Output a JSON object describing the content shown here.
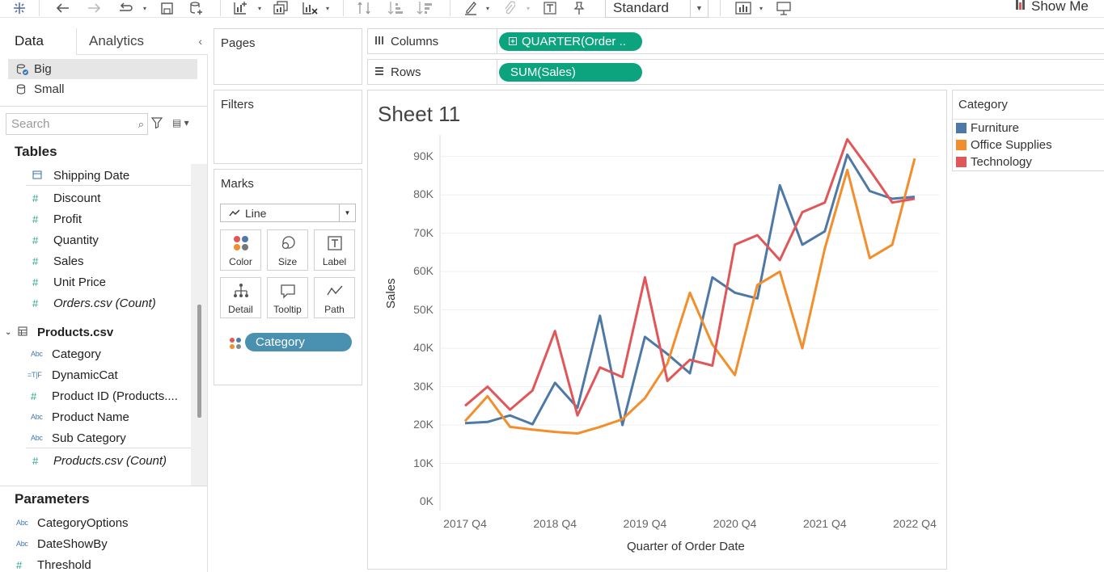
{
  "toolbar": {
    "format_select": "Standard",
    "show_me": "Show Me"
  },
  "data_pane": {
    "tabs": {
      "data": "Data",
      "analytics": "Analytics"
    },
    "datasources": [
      "Big",
      "Small"
    ],
    "search_placeholder": "Search",
    "tables_title": "Tables",
    "orders_fields": [
      "Shipping Date",
      "Discount",
      "Profit",
      "Quantity",
      "Sales",
      "Unit Price",
      "Orders.csv (Count)"
    ],
    "products_table": "Products.csv",
    "products_fields": [
      "Category",
      "DynamicCat",
      "Product ID (Products....",
      "Product Name",
      "Sub Category",
      "Products.csv (Count)"
    ],
    "parameters_title": "Parameters",
    "parameters": [
      "CategoryOptions",
      "DateShowBy",
      "Threshold"
    ]
  },
  "shelves": {
    "pages": "Pages",
    "filters": "Filters",
    "columns_label": "Columns",
    "columns_pill": "QUARTER(Order ..",
    "rows_label": "Rows",
    "rows_pill": "SUM(Sales)"
  },
  "marks": {
    "title": "Marks",
    "type": "Line",
    "buttons": [
      "Color",
      "Size",
      "Label",
      "Detail",
      "Tooltip",
      "Path"
    ],
    "color_field": "Category"
  },
  "view": {
    "sheet_title": "Sheet 11"
  },
  "legend": {
    "title": "Category"
  },
  "colors": {
    "furniture": "#4e79a7",
    "office_supplies": "#f28e2b",
    "technology": "#e15759",
    "pill_green": "#0ba47f",
    "pill_blue": "#4a90b0"
  },
  "chart_data": {
    "type": "line",
    "title": "",
    "xlabel": "Quarter of Order Date",
    "ylabel": "Sales",
    "ylim": [
      0,
      95000
    ],
    "yticks": [
      "0K",
      "10K",
      "20K",
      "30K",
      "40K",
      "50K",
      "60K",
      "70K",
      "80K",
      "90K"
    ],
    "xticks": [
      "2017 Q4",
      "2018 Q4",
      "2019 Q4",
      "2020 Q4",
      "2021 Q4",
      "2022 Q4"
    ],
    "x": [
      "2017 Q4",
      "2018 Q1",
      "2018 Q2",
      "2018 Q3",
      "2018 Q4",
      "2019 Q1",
      "2019 Q2",
      "2019 Q3",
      "2019 Q4",
      "2020 Q1",
      "2020 Q2",
      "2020 Q3",
      "2020 Q4",
      "2021 Q1",
      "2021 Q2",
      "2021 Q3",
      "2021 Q4",
      "2022 Q1",
      "2022 Q2",
      "2022 Q3",
      "2022 Q4"
    ],
    "grid": true,
    "legend_position": "right",
    "series": [
      {
        "name": "Furniture",
        "values": [
          20500,
          20800,
          22500,
          20200,
          31000,
          24500,
          48500,
          20000,
          43000,
          38500,
          33500,
          58500,
          54500,
          53000,
          82500,
          67000,
          70500,
          90500,
          81000,
          79000,
          79500
        ]
      },
      {
        "name": "Office Supplies",
        "values": [
          21000,
          27500,
          19500,
          18800,
          18200,
          17800,
          19500,
          21500,
          27000,
          36000,
          54500,
          41000,
          33000,
          56500,
          60000,
          40000,
          66000,
          86500,
          63500,
          67000,
          89500
        ]
      },
      {
        "name": "Technology",
        "values": [
          25000,
          30000,
          24000,
          29000,
          44500,
          22500,
          35000,
          32500,
          58500,
          31500,
          37000,
          35500,
          67000,
          69500,
          63000,
          75500,
          78000,
          94500,
          86500,
          78000,
          79000
        ]
      }
    ]
  }
}
